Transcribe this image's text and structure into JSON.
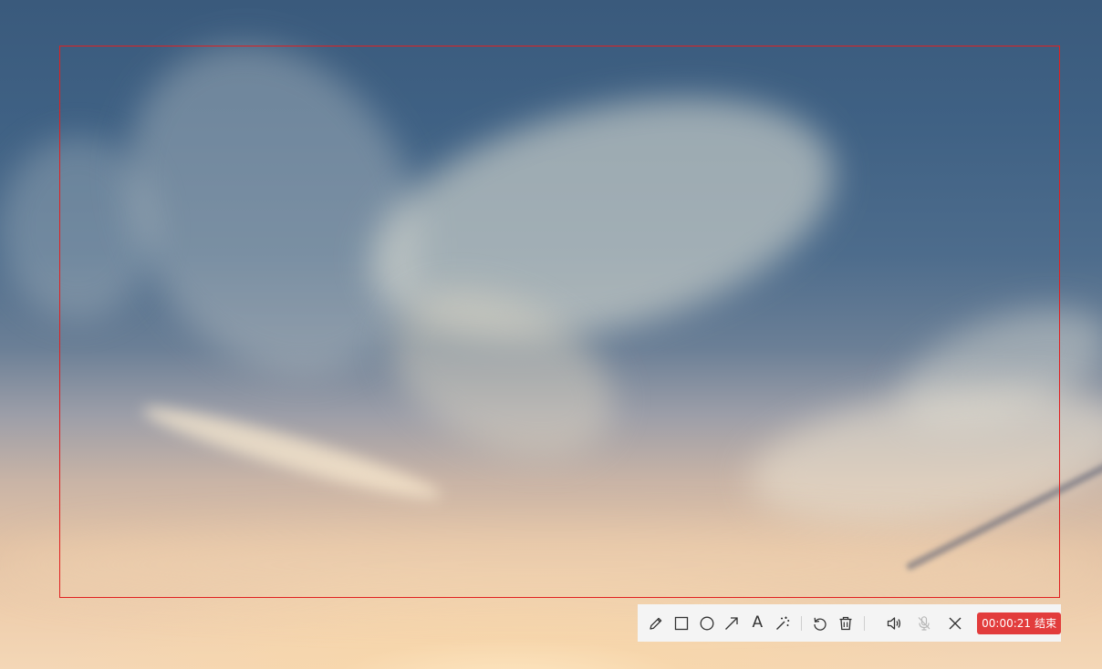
{
  "colors": {
    "capture_border": "#e02020",
    "toolbar_bg": "#f4f4f4",
    "end_button_bg": "#e23c3c",
    "end_button_text": "#ffffff",
    "icon_color": "#333333",
    "icon_disabled": "#b8b8b8"
  },
  "toolbar": {
    "tools": [
      {
        "name": "pencil-icon",
        "tool": "pen"
      },
      {
        "name": "rectangle-icon",
        "tool": "rectangle"
      },
      {
        "name": "circle-icon",
        "tool": "ellipse"
      },
      {
        "name": "arrow-icon",
        "tool": "arrow"
      },
      {
        "name": "text-icon",
        "tool": "text",
        "glyph": "A"
      },
      {
        "name": "magic-wand-icon",
        "tool": "highlight"
      }
    ],
    "actions": [
      {
        "name": "undo-icon"
      },
      {
        "name": "trash-icon"
      }
    ],
    "audio": [
      {
        "name": "speaker-icon",
        "state": "enabled"
      },
      {
        "name": "microphone-icon",
        "state": "disabled"
      }
    ],
    "close": {
      "name": "close-icon"
    },
    "recording": {
      "timer": "00:00:21",
      "end_label": "结束"
    }
  }
}
